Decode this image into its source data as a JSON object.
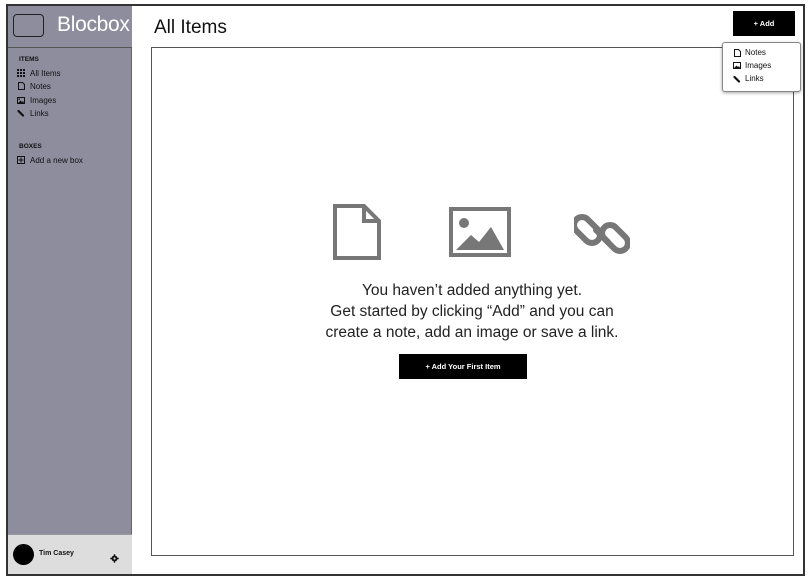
{
  "app": {
    "brand": "Blocbox"
  },
  "sidebar": {
    "items_heading": "ITEMS",
    "items": [
      {
        "label": "All Items",
        "icon": "grid-icon"
      },
      {
        "label": "Notes",
        "icon": "note-icon"
      },
      {
        "label": "Images",
        "icon": "image-icon"
      },
      {
        "label": "Links",
        "icon": "link-icon"
      }
    ],
    "boxes_heading": "BOXES",
    "boxes": [
      {
        "label": "Add a new box",
        "icon": "plus-box-icon"
      }
    ],
    "user": {
      "name": "Tim Casey",
      "icon": "gear-icon"
    }
  },
  "header": {
    "title": "All Items",
    "add_label": "+ Add"
  },
  "add_menu": {
    "items": [
      {
        "label": "Notes",
        "icon": "note-icon"
      },
      {
        "label": "Images",
        "icon": "image-icon"
      },
      {
        "label": "Links",
        "icon": "link-icon"
      }
    ]
  },
  "empty_state": {
    "line1": "You haven’t added anything yet.",
    "line2": "Get started by clicking “Add” and you can",
    "line3": "create a note, add an image or save a link.",
    "button_label": "+ Add Your First Item",
    "icons": [
      "note-icon",
      "image-icon",
      "link-icon"
    ]
  },
  "colors": {
    "sidebar": "#8e8d9e",
    "user_bar": "#dddddd",
    "button": "#000000",
    "icon_gray": "#777777"
  }
}
